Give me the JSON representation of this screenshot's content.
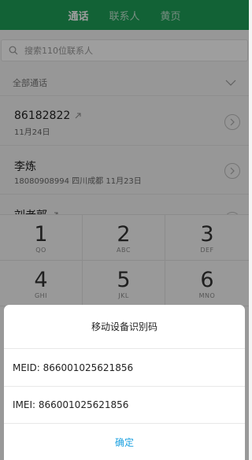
{
  "tabs": [
    {
      "label": "通话",
      "active": true
    },
    {
      "label": "联系人",
      "active": false
    },
    {
      "label": "黄页",
      "active": false
    }
  ],
  "search": {
    "placeholder": "搜索110位联系人"
  },
  "filter": {
    "label": "全部通话"
  },
  "calls": [
    {
      "name": "86182822",
      "meta": "11月24日",
      "direction_icon": "outgoing-arrow-icon"
    },
    {
      "name": "李炼",
      "meta": "18080908994  四川成都  11月23日",
      "direction_icon": ""
    },
    {
      "name": "刘老郭",
      "meta": "",
      "direction_icon": "outgoing-arrow-icon"
    }
  ],
  "keypad": [
    {
      "digit": "1",
      "letters": "QO"
    },
    {
      "digit": "2",
      "letters": "ABC"
    },
    {
      "digit": "3",
      "letters": "DEF"
    },
    {
      "digit": "4",
      "letters": "GHI"
    },
    {
      "digit": "5",
      "letters": "JKL"
    },
    {
      "digit": "6",
      "letters": "MNO"
    }
  ],
  "dialog": {
    "title": "移动设备识别码",
    "meid": "MEID: 866001025621856",
    "imei": "IMEI: 866001025621856",
    "confirm": "确定"
  },
  "colors": {
    "brand_green": "#1e9e57",
    "confirm_blue": "#1aa0e0"
  }
}
